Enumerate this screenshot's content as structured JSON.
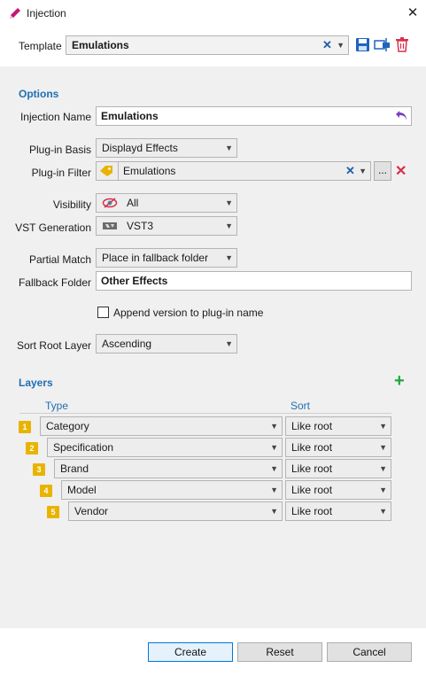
{
  "window": {
    "title": "Injection"
  },
  "template": {
    "label": "Template",
    "value": "Emulations"
  },
  "options": {
    "heading": "Options",
    "injection_name_label": "Injection Name",
    "injection_name_value": "Emulations",
    "plugin_basis_label": "Plug-in Basis",
    "plugin_basis_value": "Displayd Effects",
    "plugin_filter_label": "Plug-in Filter",
    "plugin_filter_value": "Emulations",
    "plugin_filter_browse": "...",
    "visibility_label": "Visibility",
    "visibility_value": "All",
    "vst_generation_label": "VST Generation",
    "vst_generation_value": "VST3",
    "partial_match_label": "Partial Match",
    "partial_match_value": "Place in fallback folder",
    "fallback_folder_label": "Fallback Folder",
    "fallback_folder_value": "Other Effects",
    "append_version_label": "Append version to plug-in name",
    "append_version_checked": false,
    "sort_root_label": "Sort Root Layer",
    "sort_root_value": "Ascending"
  },
  "layers": {
    "heading": "Layers",
    "col_type": "Type",
    "col_sort": "Sort",
    "rows": [
      {
        "badge": "1",
        "type": "Category",
        "sort": "Like root"
      },
      {
        "badge": "2",
        "type": "Specification",
        "sort": "Like root"
      },
      {
        "badge": "3",
        "type": "Brand",
        "sort": "Like root"
      },
      {
        "badge": "4",
        "type": "Model",
        "sort": "Like root"
      },
      {
        "badge": "5",
        "type": "Vendor",
        "sort": "Like root"
      }
    ]
  },
  "footer": {
    "create": "Create",
    "reset": "Reset",
    "cancel": "Cancel"
  },
  "colors": {
    "accent": "#1f6fb2",
    "badge": "#e8b400",
    "delete": "#d9304d",
    "add": "#1fa83a"
  },
  "icons": [
    "pencil-icon",
    "close-icon",
    "save-icon",
    "rename-icon",
    "trash-icon",
    "undo-icon",
    "tag-icon",
    "eye-icon",
    "vst-icon",
    "add-icon"
  ]
}
